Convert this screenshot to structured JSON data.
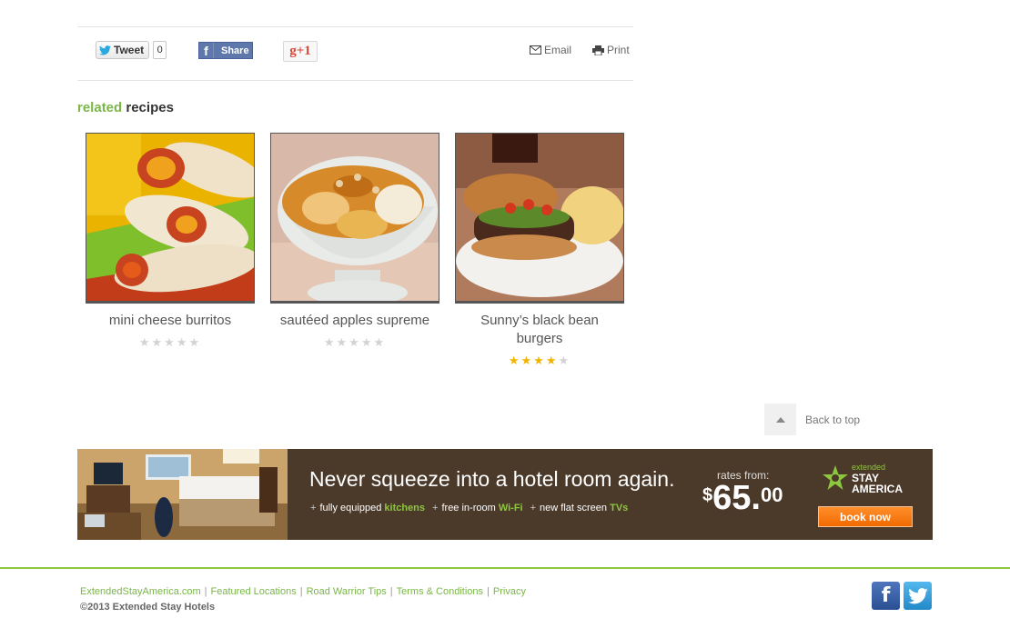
{
  "share": {
    "tweet_label": "Tweet",
    "tweet_count": "0",
    "fb_label": "Share",
    "gplus_label": "g+1",
    "email_label": "Email",
    "print_label": "Print"
  },
  "related": {
    "title_accent": "related",
    "title_rest": "recipes",
    "items": [
      {
        "name": "mini cheese burritos",
        "rating": 0,
        "max": 5
      },
      {
        "name": "sautéed apples supreme",
        "rating": 0,
        "max": 5
      },
      {
        "name": "Sunny’s black bean burgers",
        "rating": 4,
        "max": 5
      }
    ]
  },
  "back_to_top": "Back to top",
  "banner": {
    "headline": "Never squeeze into a hotel room again.",
    "amenities": [
      {
        "text": "fully equipped ",
        "highlight": "kitchens"
      },
      {
        "text": "free in-room ",
        "highlight": "Wi-Fi"
      },
      {
        "text": "new flat screen ",
        "highlight": "TVs"
      }
    ],
    "rates_label": "rates from:",
    "price_dollar": "$",
    "price_whole": "65.",
    "price_cents": "00",
    "logo_extended": "extended",
    "logo_stay": "STAY",
    "logo_america": "AMERICA",
    "book_label": "book now"
  },
  "footer": {
    "links": [
      "ExtendedStayAmerica.com",
      "Featured Locations",
      "Road Warrior Tips",
      "Terms & Conditions",
      "Privacy"
    ],
    "copyright": "©2013 Extended Stay Hotels"
  },
  "colors": {
    "accent_green": "#7ab648",
    "banner_brown": "#4b3a2a",
    "book_orange": "#f37b12",
    "star_gold": "#f3b400"
  }
}
